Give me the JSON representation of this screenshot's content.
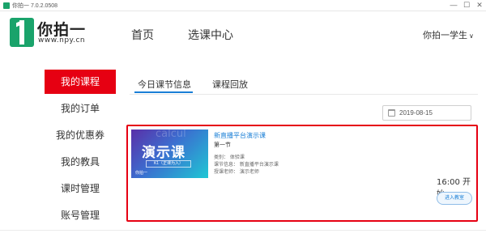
{
  "window": {
    "title": "你拍一 7.0.2.0508",
    "minimize": "—",
    "maximize": "☐",
    "close": "✕"
  },
  "logo": {
    "name": "你拍一",
    "url": "www.npy.cn",
    "brand_color": "#1aa36b"
  },
  "nav": {
    "home": "首页",
    "course_select": "选课中心",
    "user": "你拍一学生",
    "user_caret": "∨"
  },
  "sidebar": {
    "items": [
      {
        "label": "我的课程",
        "active": true
      },
      {
        "label": "我的订单",
        "active": false
      },
      {
        "label": "我的优惠券",
        "active": false
      },
      {
        "label": "我的教具",
        "active": false
      },
      {
        "label": "课时管理",
        "active": false
      },
      {
        "label": "账号管理",
        "active": false
      }
    ],
    "active_color": "#e60012"
  },
  "tabs": {
    "today": "今日课节信息",
    "replay": "课程回放",
    "active_color": "#1a7fd6"
  },
  "date_picker": {
    "value": "2019-08-15",
    "icon": "calendar-icon"
  },
  "course": {
    "thumbnail": {
      "title": "演示课",
      "subtitle": "K1（正课为入）",
      "brand": "你拍一"
    },
    "name": "新直播平台演示课",
    "lesson": "第一节",
    "info": {
      "category": "类别：  体验课",
      "lesson_info": "课节信息：  新直播平台演示课",
      "teacher": "授课老师：  演示老师"
    },
    "start_time": "16:00 开始",
    "enter_button": "进入教室"
  }
}
